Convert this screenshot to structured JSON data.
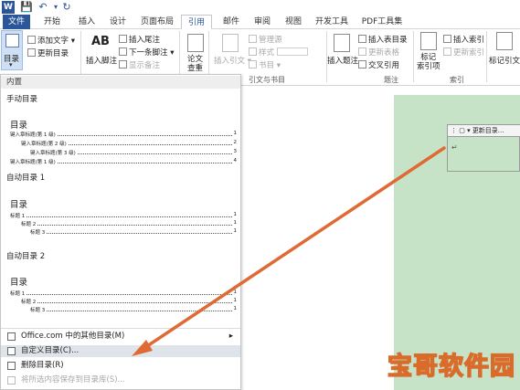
{
  "quick_access": {
    "word_icon": "W",
    "save_icon": "save-icon",
    "undo_icon": "undo-icon",
    "redo_icon": "redo-icon"
  },
  "tabs": [
    {
      "label": "文件"
    },
    {
      "label": "开始"
    },
    {
      "label": "插入"
    },
    {
      "label": "设计"
    },
    {
      "label": "页面布局"
    },
    {
      "label": "引用"
    },
    {
      "label": "邮件"
    },
    {
      "label": "审阅"
    },
    {
      "label": "视图"
    },
    {
      "label": "开发工具"
    },
    {
      "label": "PDF工具集"
    }
  ],
  "ribbon": {
    "toc_label": "目录",
    "add_text": "添加文字",
    "update_toc": "更新目录",
    "footnote_big": "AB",
    "insert_footnote": "插入脚注",
    "insert_endnote": "插入尾注",
    "next_footnote": "下一条脚注",
    "show_notes": "显示备注",
    "paper_check": "论文\n查重",
    "insert_citation": "插入引文",
    "manage_sources": "管理源",
    "style": "样式",
    "bibliography": "书目",
    "group_citations": "引文与书目",
    "insert_caption": "插入题注",
    "insert_table_of_figures": "插入表目录",
    "update_table": "更新表格",
    "cross_reference": "交叉引用",
    "group_captions": "题注",
    "mark_entry": "标记\n索引项",
    "insert_index": "插入索引",
    "update_index": "更新索引",
    "group_index": "索引",
    "mark_citation": "标记引文"
  },
  "dropdown": {
    "header": "内置",
    "manual_label": "手动目录",
    "manual_title": "目录",
    "manual_entries": [
      "键入章标题(第 1 级)",
      "键入章标题(第 2 级)",
      "键入章标题(第 3 级)",
      "键入章标题(第 1 级)"
    ],
    "manual_pages": [
      "1",
      "2",
      "3",
      "4"
    ],
    "auto1_label": "自动目录 1",
    "auto1_title": "目录",
    "auto1_entries": [
      "标题 1",
      "标题 2",
      "标题 3"
    ],
    "auto_pages": [
      "1",
      "1",
      "1"
    ],
    "auto2_label": "自动目录 2",
    "auto2_title": "目录",
    "auto2_entries": [
      "标题 1",
      "标题 2",
      "标题 3"
    ],
    "more_toc": "Office.com 中的其他目录(M)",
    "custom_toc": "自定义目录(C)...",
    "remove_toc": "删除目录(R)",
    "save_selection": "将所选内容保存到目录库(S)..."
  },
  "doc": {
    "field_toolbar": "更新目录..."
  },
  "watermark": "宝哥软件园",
  "colors": {
    "file_tab": "#2b579a",
    "page_green": "#c6e3c8",
    "arrow": "#e06a33",
    "highlight": "#dfe3ea"
  }
}
